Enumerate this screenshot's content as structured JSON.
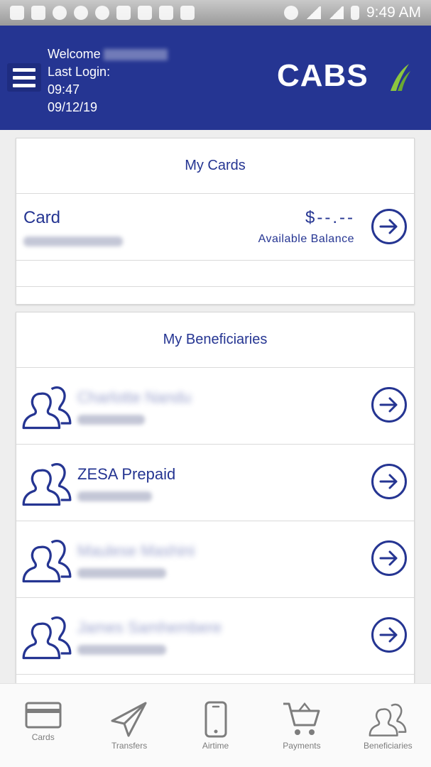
{
  "status_bar": {
    "time": "9:49 AM"
  },
  "header": {
    "welcome_label": "Welcome",
    "last_login_label": "Last Login:",
    "last_login_time": "09:47",
    "last_login_date": "09/12/19",
    "logo_text": "CABS"
  },
  "cards_section": {
    "title": "My Cards",
    "card_label": "Card",
    "balance_value": "$--.--",
    "balance_label": "Available Balance"
  },
  "beneficiaries_section": {
    "title": "My Beneficiaries",
    "items": [
      {
        "name": "Charlotte Nandu"
      },
      {
        "name": "ZESA Prepaid"
      },
      {
        "name": "Maulese Mashini"
      },
      {
        "name": "James Samhembere"
      }
    ]
  },
  "bottom_nav": {
    "items": [
      {
        "label": "Cards",
        "icon": "card-icon"
      },
      {
        "label": "Transfers",
        "icon": "paper-plane-icon"
      },
      {
        "label": "Airtime",
        "icon": "phone-icon"
      },
      {
        "label": "Payments",
        "icon": "cart-icon"
      },
      {
        "label": "Beneficiaries",
        "icon": "people-icon"
      }
    ]
  },
  "colors": {
    "brand_blue": "#253592",
    "logo_accent": "#8cc63f"
  }
}
